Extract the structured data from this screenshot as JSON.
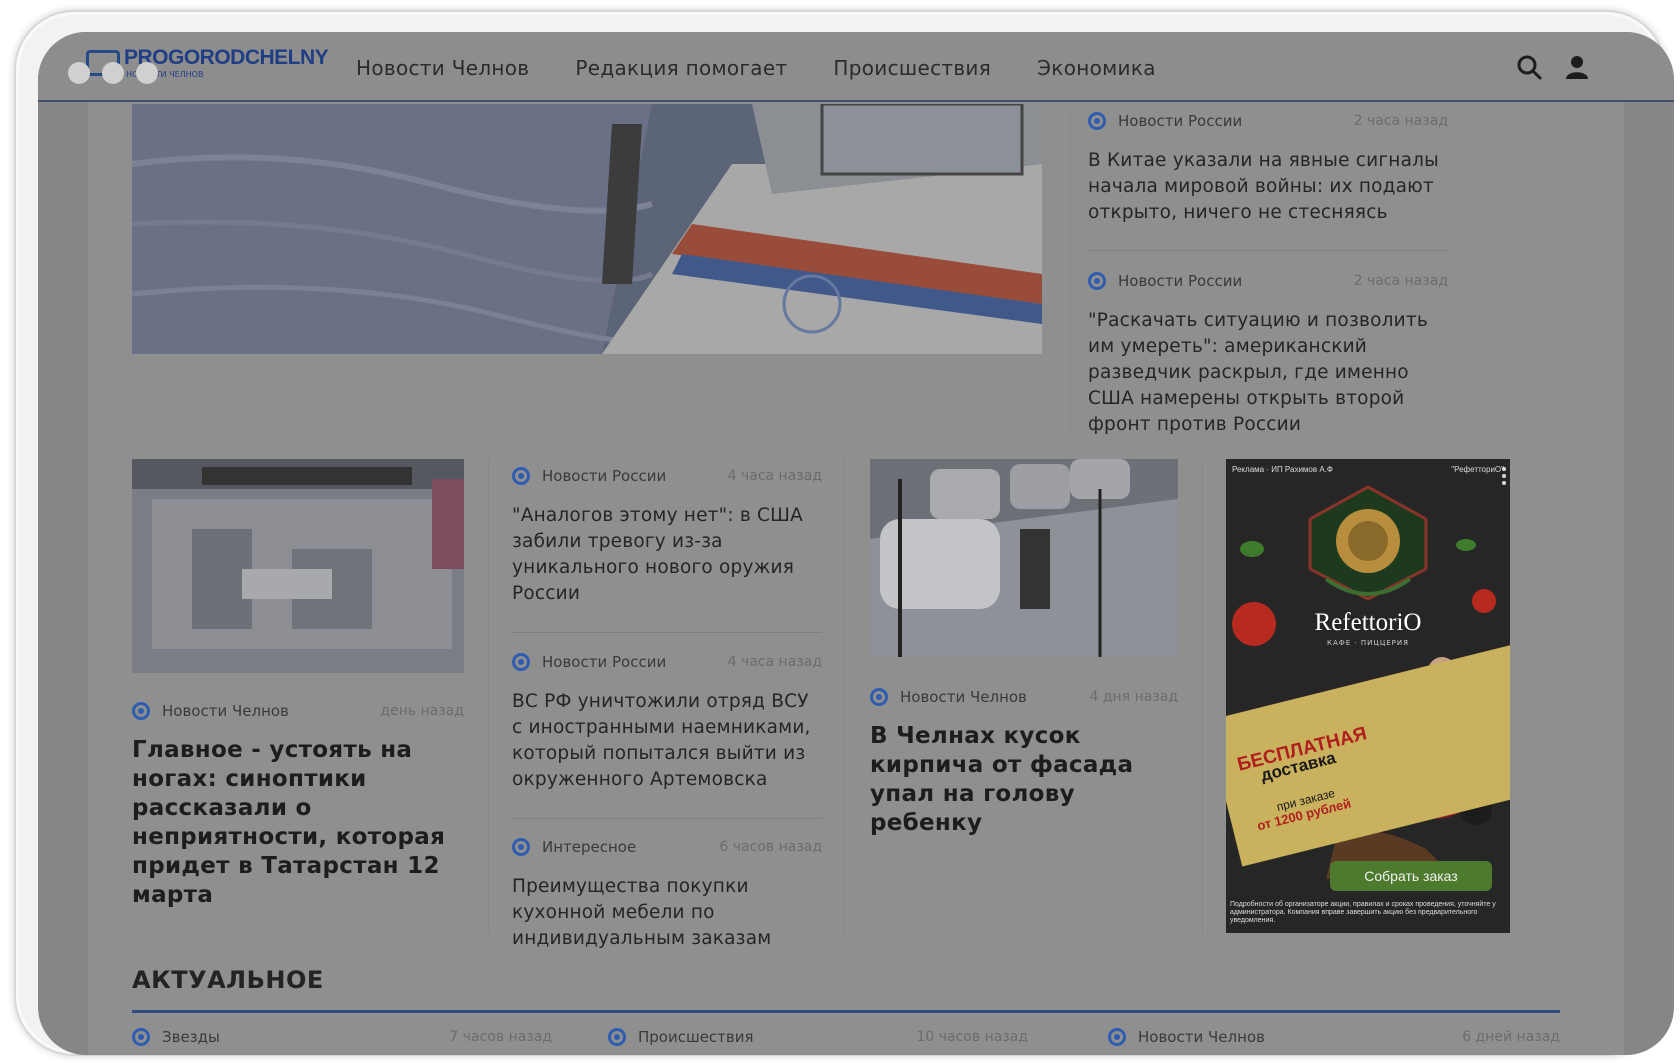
{
  "header": {
    "logo_text": "PROGORODCHELNY",
    "logo_sub": "НОВОСТИ ЧЕЛНОВ",
    "nav": [
      {
        "label": "Новости Челнов"
      },
      {
        "label": "Редакция помогает"
      },
      {
        "label": "Происшествия"
      },
      {
        "label": "Экономика"
      }
    ]
  },
  "side_news": [
    {
      "category": "Новости России",
      "time": "2 часа назад",
      "title": "В Китае указали на явные сигналы начала мировой войны: их подают открыто, ничего не стесняясь"
    },
    {
      "category": "Новости России",
      "time": "2 часа назад",
      "title": "\"Раскачать ситуацию и позволить им умереть\": американский разведчик раскрыл, где именно США намерены открыть второй фронт против России"
    }
  ],
  "feature_left": {
    "category": "Новости Челнов",
    "time": "день назад",
    "title": "Главное - устоять на ногах: синоптики рассказали о неприятности, которая придет в Татарстан 12 марта"
  },
  "middle_news": [
    {
      "category": "Новости России",
      "time": "4 часа назад",
      "title": "\"Аналогов этому нет\": в США забили тревогу из-за уникального нового оружия России"
    },
    {
      "category": "Новости России",
      "time": "4 часа назад",
      "title": "ВС РФ уничтожили отряд ВСУ с иностранными наемниками, который попытался выйти из окруженного Артемовска"
    },
    {
      "category": "Интересное",
      "time": "6 часов назад",
      "title": "Преимущества покупки кухонной мебели по индивидуальным заказам"
    }
  ],
  "feature_right": {
    "category": "Новости Челнов",
    "time": "4 дня назад",
    "title": "В Челнах кусок кирпича от фасада упал на голову ребенку"
  },
  "ad": {
    "label_left": "Реклама · ИП Рахимов А.Ф",
    "label_right": "\"РефетториО\"",
    "brand": "RefettoriO",
    "brand_sub": "КАФЕ · ПИЦЦЕРИЯ",
    "free": "БЕСПЛАТНАЯ",
    "delivery": "доставка",
    "order": "при заказе",
    "price": "от 1200 рублей",
    "button": "Собрать заказ",
    "fine_print": "Подробности об организаторе акции, правилах и сроках проведения, уточняйте у администратора. Компания вправе завершить акцию без предварительного уведомления."
  },
  "section": {
    "title": "АКТУАЛЬНОЕ",
    "items": [
      {
        "category": "Звезды",
        "time": "7 часов назад"
      },
      {
        "category": "Происшествия",
        "time": "10 часов назад"
      },
      {
        "category": "Новости Челнов",
        "time": "6 дней назад"
      }
    ]
  }
}
